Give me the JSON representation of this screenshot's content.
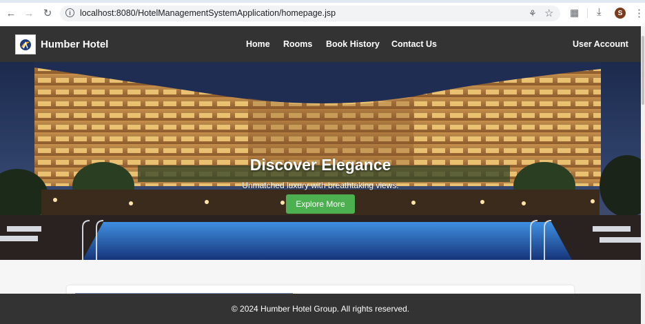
{
  "browser": {
    "url": "localhost:8080/HotelManagementSystemApplication/homepage.jsp",
    "profile_initial": "S",
    "icons": [
      "back-icon",
      "forward-icon",
      "reload-icon",
      "site-info-icon",
      "password-key-icon",
      "bookmark-star-icon",
      "extensions-icon",
      "download-icon",
      "menu-icon"
    ]
  },
  "header": {
    "brand": "Humber Hotel",
    "nav": [
      "Home",
      "Rooms",
      "Book History",
      "Contact Us"
    ],
    "account": "User Account"
  },
  "hero": {
    "title": "Discover Elegance",
    "subtitle": "Unmatched luxury with breathtaking views.",
    "button": "Explore More"
  },
  "footer": {
    "text": "© 2024 Humber Hotel Group. All rights reserved."
  },
  "colors": {
    "header_bg": "#333333",
    "button_green": "#4caf50",
    "page_bg": "#f6f6f6"
  }
}
